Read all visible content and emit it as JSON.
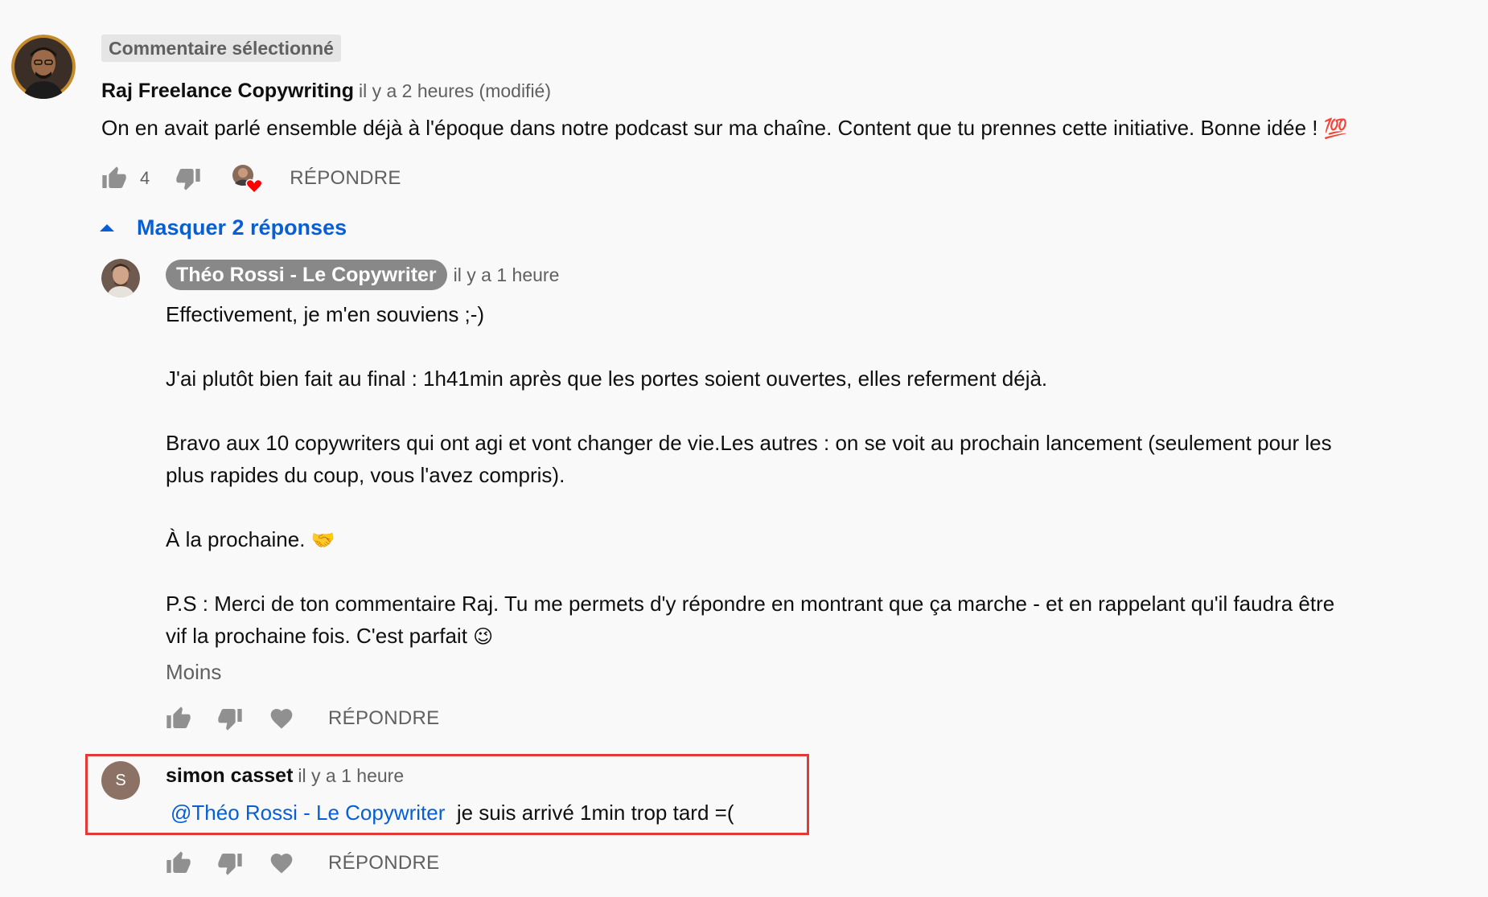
{
  "colors": {
    "background": "#f9f9f9",
    "link": "#065fd4",
    "muted": "#606060",
    "highlight_border": "#e53935"
  },
  "main_comment": {
    "badge": "Commentaire sélectionné",
    "author": "Raj Freelance Copywriting",
    "time": "il y a 2 heures (modifié)",
    "text": "On en avait parlé ensemble déjà à l'époque dans notre podcast sur ma chaîne. Content que tu prennes cette initiative. Bonne idée !",
    "text_emoji": "💯",
    "like_count": "4",
    "reply_label": "RÉPONDRE",
    "hide_replies_label": "Masquer 2 réponses"
  },
  "reply_1": {
    "author": "Théo Rossi - Le Copywriter",
    "time": "il y a 1 heure",
    "paragraphs": [
      "Effectivement, je m'en souviens ;-)",
      "J'ai plutôt bien fait au final : 1h41min après que les portes soient ouvertes, elles referment déjà.",
      "Bravo aux 10 copywriters qui ont agi et vont changer de vie.Les autres : on se voit au prochain lancement (seulement pour les",
      "plus rapides du coup, vous l'avez compris).",
      "À la prochaine.",
      "P.S : Merci de ton commentaire Raj. Tu me permets d'y répondre en montrant que ça marche - et en rappelant qu'il faudra être",
      "vif la prochaine fois. C'est parfait"
    ],
    "emoji_handshake": "🤝",
    "emoji_wink": "😉",
    "less_label": "Moins",
    "reply_label": "RÉPONDRE"
  },
  "reply_2": {
    "avatar_letter": "S",
    "author": "simon casset",
    "time": "il y a 1 heure",
    "mention": "@Théo Rossi - Le Copywriter",
    "text": "je suis arrivé 1min trop tard =(",
    "reply_label": "RÉPONDRE"
  }
}
